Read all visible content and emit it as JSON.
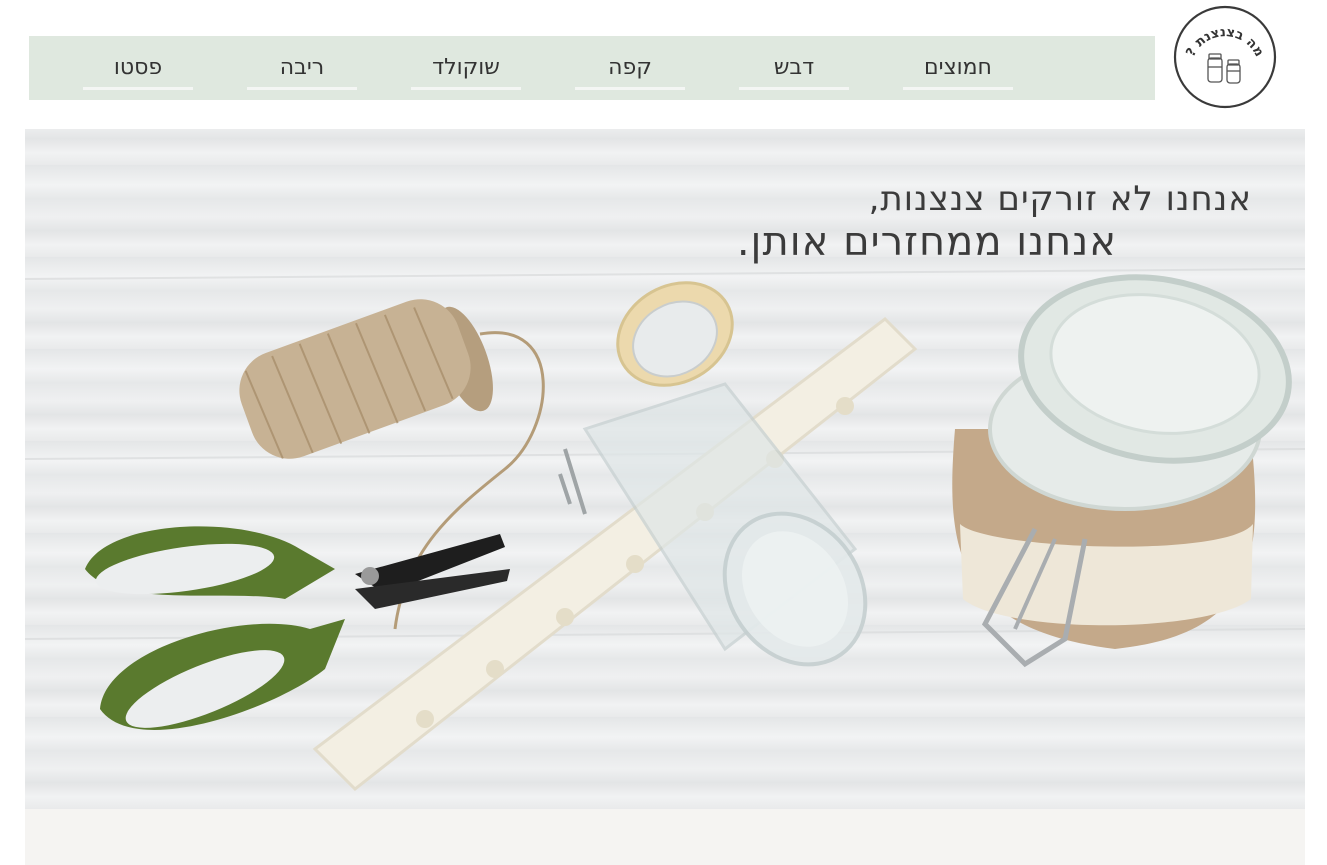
{
  "site": {
    "logo_text": "מה בצנצנת ?",
    "logo_icon": "jars-icon"
  },
  "nav": {
    "items": [
      {
        "label": "פסטו"
      },
      {
        "label": "ריבה"
      },
      {
        "label": "שוקולד"
      },
      {
        "label": "קפה"
      },
      {
        "label": "דבש"
      },
      {
        "label": "חמוצים"
      }
    ]
  },
  "hero": {
    "line1": "אנחנו לא זורקים צנצנות,",
    "line2": "אנחנו ממחזרים אותן."
  },
  "colors": {
    "nav_bg": "#dfe8df",
    "text": "#333333",
    "strip_bg": "#f5f4f2",
    "scissors_green": "#5a7a2e"
  }
}
